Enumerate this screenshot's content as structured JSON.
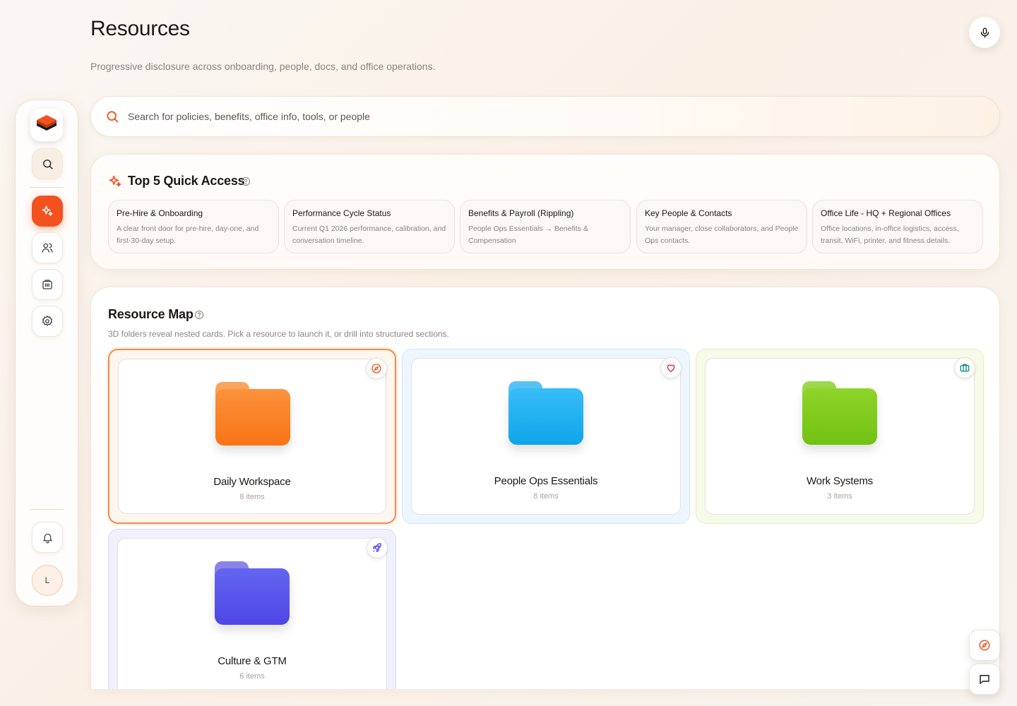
{
  "header": {
    "title": "Resources",
    "subtitle": "Progressive disclosure across onboarding, people, docs, and office operations."
  },
  "search": {
    "placeholder": "Search for policies, benefits, office info, tools, or people",
    "value": ""
  },
  "sidebar": {
    "avatar_initial": "L",
    "items": [
      {
        "name": "search",
        "icon": "search-icon"
      },
      {
        "name": "quick-access",
        "icon": "sparkles-icon",
        "active": true
      },
      {
        "name": "people",
        "icon": "users-icon"
      },
      {
        "name": "office",
        "icon": "building-icon"
      },
      {
        "name": "settings",
        "icon": "gear-icon"
      },
      {
        "name": "notifications",
        "icon": "bell-icon"
      }
    ]
  },
  "quick_access": {
    "title": "Top 5 Quick Access",
    "cards": [
      {
        "title": "Pre-Hire & Onboarding",
        "desc": "A clear front door for pre-hire, day-one, and first-30-day setup."
      },
      {
        "title": "Performance Cycle Status",
        "desc": "Current Q1 2026 performance, calibration, and conversation timeline."
      },
      {
        "title": "Benefits & Payroll (Rippling)",
        "desc": "People Ops Essentials → Benefits & Compensation"
      },
      {
        "title": "Key People & Contacts",
        "desc": "Your manager, close collaborators, and People Ops contacts."
      },
      {
        "title": "Office Life - HQ + Regional Offices",
        "desc": "Office locations, in-office logistics, access, transit, WiFi, printer, and fitness details."
      }
    ]
  },
  "resource_map": {
    "title": "Resource Map",
    "desc": "3D folders reveal nested cards. Pick a resource to launch it, or drill into structured sections.",
    "folders": [
      {
        "name": "Daily Workspace",
        "count": "8 items",
        "icon": "compass-icon",
        "color": "#f97316",
        "selected": true
      },
      {
        "name": "People Ops Essentials",
        "count": "8 items",
        "icon": "heart-icon",
        "color": "#0ea5e9"
      },
      {
        "name": "Work Systems",
        "count": "3 items",
        "icon": "briefcase-icon",
        "color": "#7cc61a"
      },
      {
        "name": "Culture & GTM",
        "count": "6 items",
        "icon": "rocket-icon",
        "color": "#5046e5"
      }
    ]
  },
  "colors": {
    "accent": "#f4511e",
    "orange": "#f97316",
    "blue": "#0ea5e9",
    "green": "#7cc61a",
    "purple": "#5046e5"
  }
}
